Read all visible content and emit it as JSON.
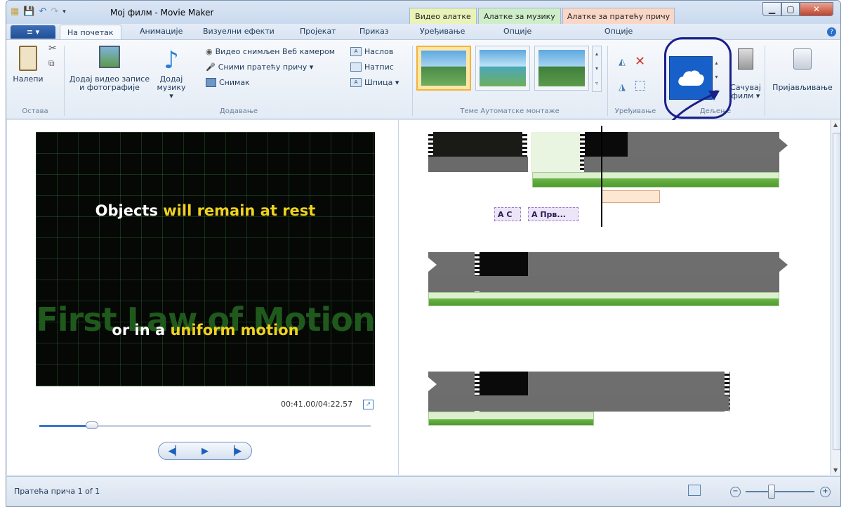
{
  "window": {
    "title": "Мој филм - Movie Maker",
    "controls": [
      "minimize",
      "maximize",
      "close"
    ]
  },
  "context_tabs": {
    "video_tools": "Видео алатке",
    "music_tools": "Алатке за музику",
    "narration_tools": "Алатке за пратећу причу"
  },
  "tabs": {
    "file": "≡ ▾",
    "home": "На почетак",
    "animations": "Анимације",
    "visual_effects": "Визуелни ефекти",
    "project": "Пројекат",
    "view": "Приказ",
    "edit": "Уређивање",
    "options1": "Опције",
    "options2": "Опције"
  },
  "ribbon": {
    "paste": "Налепи",
    "clipboard_group": "Остава",
    "add_videos_l1": "Додај видео записе",
    "add_videos_l2": "и фотографије",
    "add_music_l1": "Додај",
    "add_music_l2": "музику ▾",
    "webcam": "Видео снимљен Веб камером",
    "record_narration": "Сними пратећу причу ▾",
    "snapshot": "Снимак",
    "title": "Наслов",
    "caption": "Натпис",
    "credits": "Шпица ▾",
    "add_group": "Додавање",
    "themes_group": "Теме Аутоматске монтаже",
    "editing_group": "Уређивање",
    "sharing_group": "Дељење",
    "save_movie_l1": "Сачувај",
    "save_movie_l2": "филм ▾",
    "sign_in": "Пријављивање"
  },
  "preview": {
    "text1_white": "Objects ",
    "text1_yellow": "will remain at rest",
    "text_ghost": "First Law of Motion",
    "text2_white": "or in a ",
    "text2_yellow": "uniform motion",
    "timecode": "00:41.00/04:22.57",
    "seek_fraction": 0.16
  },
  "timeline": {
    "caption_a": "A C",
    "caption_b": "A Прв..."
  },
  "status": {
    "narration": "Пратећа прича 1 of 1"
  },
  "colors": {
    "accent": "#1f4f95",
    "annotation": "#1b1f8a",
    "caption_yellow": "#f0d21e"
  }
}
